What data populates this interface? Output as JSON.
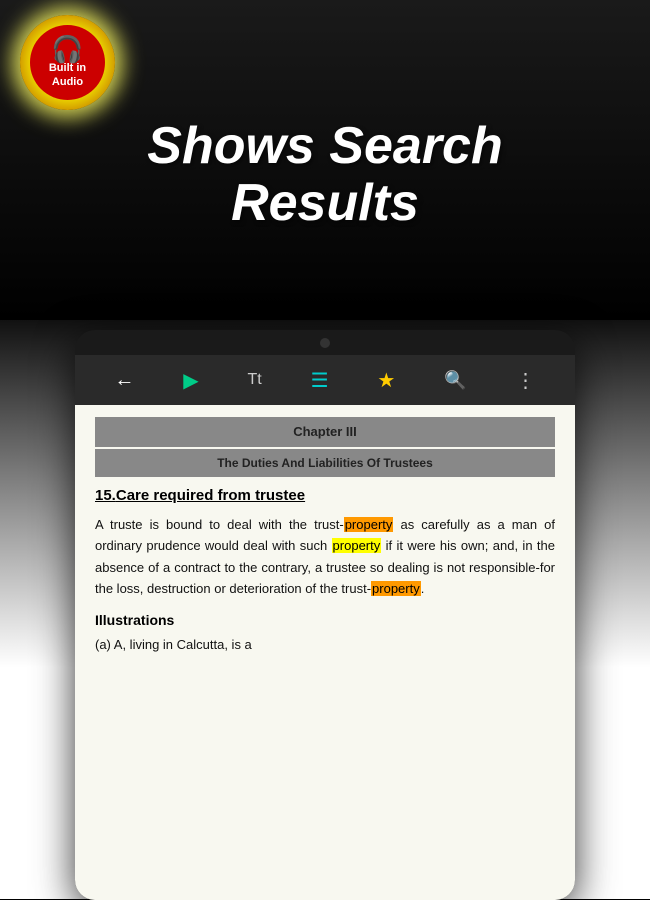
{
  "top": {
    "badge": {
      "line1": "Built in",
      "line2": "Audio"
    },
    "title_line1": "Shows Search",
    "title_line2": "Results"
  },
  "toolbar": {
    "back_label": "←",
    "play_icon": "▶",
    "text_icon": "Tt",
    "comment_icon": "≡",
    "star_icon": "★",
    "search_icon": "🔍",
    "more_icon": "⋮"
  },
  "book": {
    "chapter_number": "Chapter III",
    "chapter_subtitle": "The Duties And Liabilities Of Trustees",
    "section_number": "15.",
    "section_title": "Care required from trustee",
    "body_text_parts": [
      "A truste is bound to deal with the trust-",
      "property",
      " as carefully as a man of ordinary prudence would deal with such ",
      "property",
      " if it were his own; and, in the absence of a contract to the contrary, a trustee so dealing is not responsible-for the loss, destruction or deterioration of the trust-",
      "property",
      "."
    ],
    "illustrations_label": "Illustrations",
    "illustration_a": "(a) A, living in Calcutta, is a"
  }
}
